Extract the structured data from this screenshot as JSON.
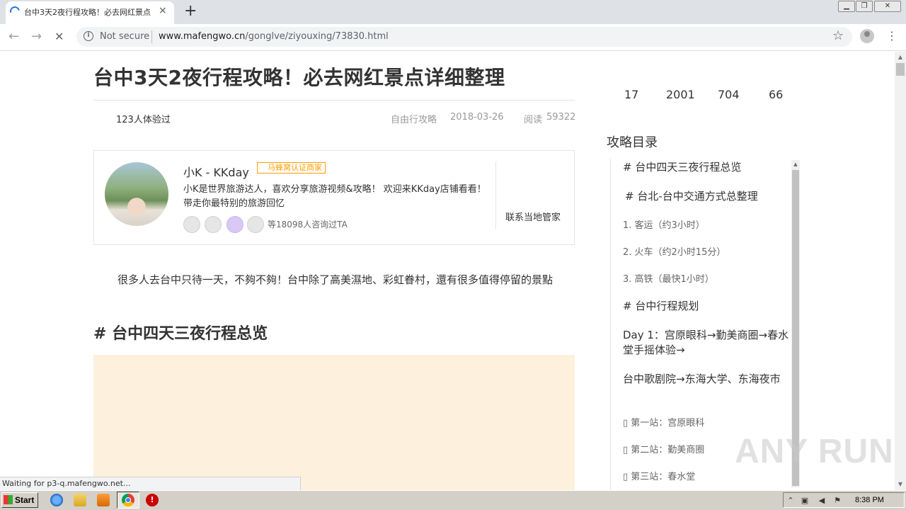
{
  "browser": {
    "tab_title": "台中3天2夜行程攻略！必去网红景点",
    "tab_close": "×",
    "new_tab": "+",
    "security_label": "Not secure",
    "url_domain": "www.mafengwo.cn",
    "url_path": "/gonglve/ziyouxing/73830.html",
    "status_text": "Waiting for p3-q.mafengwo.net..."
  },
  "article": {
    "title": "台中3天2夜行程攻略！必去网红景点详细整理",
    "verified": "123人体验过",
    "category": "自由行攻略",
    "date": "2018-03-26",
    "views_label": "阅读",
    "views": "59322",
    "intro": "很多人去台中只待一天，不夠不夠！台中除了高美濕地、彩虹眷村，還有很多值得停留的景點",
    "section_heading": "# 台中四天三夜行程总览"
  },
  "author": {
    "name": "小K - KKday",
    "badge": "马蜂窝认证商家",
    "bio": "小K是世界旅游达人，喜欢分享旅游视频&攻略！ 欢迎来KKday店铺看看！带走你最特别的旅游回忆",
    "consult_count": "等18098人咨询过TA",
    "contact_label": "联系当地管家"
  },
  "stats": [
    "17",
    "2001",
    "704",
    "66"
  ],
  "toc": {
    "title": "攻略目录",
    "items": [
      "# 台中四天三夜行程总览",
      "# 台北-台中交通方式总整理",
      "1. 客运（约3小时）",
      "2. 火车（约2小时15分）",
      "3. 高铁（最快1小时）",
      "# 台中行程规划",
      "Day 1：宫原眼科→勤美商圈→春水堂手摇体验→",
      "台中歌剧院→东海大学、东海夜市",
      "▯ 第一站：宫原眼科",
      "▯ 第二站：勤美商圈",
      "▯ 第三站：春水堂"
    ]
  },
  "watermark": "ANY RUN",
  "taskbar": {
    "start_label": "Start",
    "clock": "8:38 PM"
  },
  "icons": {
    "back": "arrow-left-icon",
    "forward": "arrow-right-icon",
    "stop": "close-icon",
    "info": "info-icon",
    "star": "star-icon",
    "profile": "profile-icon",
    "menu": "more-vert-icon"
  },
  "colors": {
    "badge": "#ff9d00",
    "placeholder": "#fdf0dd",
    "chrome_bg": "#dee1e6"
  }
}
